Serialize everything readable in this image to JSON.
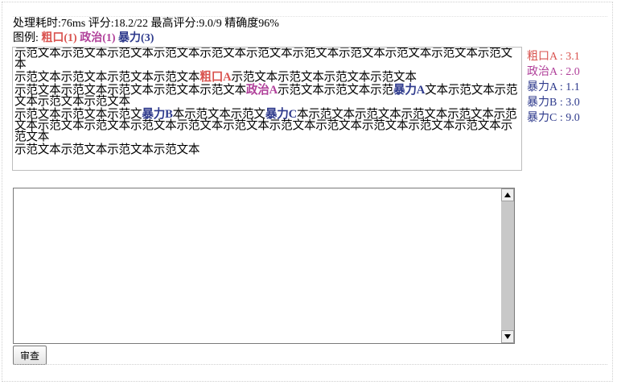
{
  "stats": {
    "text": "处理耗时:76ms 评分:18.2/22 最高评分:9.0/9 精确度96%"
  },
  "legend": {
    "label": "图例:",
    "items": [
      {
        "text": "粗口(1)",
        "color": "#d9534f"
      },
      {
        "text": "政治(1)",
        "color": "#b0409a"
      },
      {
        "text": "暴力(3)",
        "color": "#2e3a8c"
      }
    ]
  },
  "content": {
    "paragraphs": [
      [
        {
          "t": "示范文本示范文本示范文本示范文本示范文本示范文本示范文本示范文本示范文本示范文本示范文本"
        }
      ],
      [
        {
          "t": "示范文本示范文本示范文本示范文本"
        },
        {
          "t": "粗口A",
          "cls": "c-coarse"
        },
        {
          "t": "示范文本示范文本示范文本示范文本"
        }
      ],
      [
        {
          "t": "示范文本示范文本示范文本示范文本示范文本"
        },
        {
          "t": "政治A",
          "cls": "c-pol"
        },
        {
          "t": "示范文本示范文本示范"
        },
        {
          "t": "暴力A",
          "cls": "c-vio"
        },
        {
          "t": "文本示范文本示范文本示范文本示范文本"
        }
      ],
      [
        {
          "t": "示范文本示范文本示范文"
        },
        {
          "t": "暴力B",
          "cls": "c-vio"
        },
        {
          "t": "本示范文本示范文"
        },
        {
          "t": "暴力C",
          "cls": "c-vio"
        },
        {
          "t": "本示范文本示范文本示范文本示范文本示范文本示范文本示范文本示范文本示范文本示范文本示范文本示范文本示范文本示范文本示范文本示范文本"
        }
      ],
      [
        {
          "t": "示范文本示范文本示范文本示范文本"
        }
      ]
    ]
  },
  "scores": [
    {
      "text": "粗口A : 3.1",
      "color": "#d9534f"
    },
    {
      "text": "政治A : 2.0",
      "color": "#b0409a"
    },
    {
      "text": "暴力A : 1.1",
      "color": "#2e3a8c"
    },
    {
      "text": "暴力B : 3.0",
      "color": "#2e3a8c"
    },
    {
      "text": "暴力C : 9.0",
      "color": "#2e3a8c"
    }
  ],
  "input": {
    "value": "",
    "placeholder": ""
  },
  "buttons": {
    "audit": "审查"
  },
  "icons": {
    "scroll_up": "triangle-up-icon",
    "scroll_down": "triangle-down-icon"
  }
}
